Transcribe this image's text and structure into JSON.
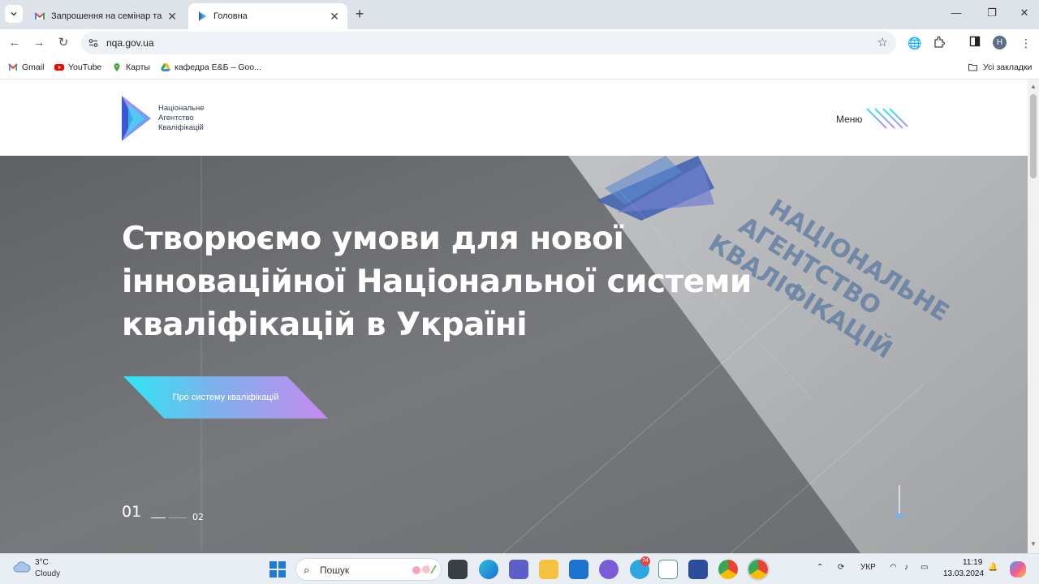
{
  "browser": {
    "tabs": [
      {
        "title": "Запрошення на семінар та під",
        "active": false,
        "icon": "gmail-icon"
      },
      {
        "title": "Головна",
        "active": true,
        "icon": "nqa-icon"
      }
    ],
    "new_tab": "+",
    "url": "nqa.gov.ua",
    "profile_initial": "H",
    "bookmarks": [
      {
        "label": "Gmail",
        "icon": "gmail-icon"
      },
      {
        "label": "YouTube",
        "icon": "youtube-icon"
      },
      {
        "label": "Карты",
        "icon": "maps-icon"
      },
      {
        "label": "кафедра Е&Б – Goo...",
        "icon": "drive-icon"
      }
    ],
    "all_bookmarks": "Усі закладки"
  },
  "site": {
    "logo_lines": [
      "Національне",
      "Агентство",
      "Кваліфікацій"
    ],
    "menu_label": "Меню",
    "hero_title_lines": [
      "Створюємо умови для нової",
      "інноваційної Національної системи",
      "кваліфікацій в Україні"
    ],
    "cta_label": "Про систему кваліфікацій",
    "slide_current": "01",
    "slide_next": "02",
    "background_card_lines": [
      "НАЦІОНАЛЬНЕ",
      "АГЕНТСТВО",
      "КВАЛІФІКАЦІЙ"
    ]
  },
  "taskbar": {
    "weather_temp": "3°C",
    "weather_desc": "Cloudy",
    "search_placeholder": "Пошук",
    "telegram_badge": "74",
    "language": "УКР",
    "time": "11:19",
    "date": "13.03.2024"
  },
  "colors": {
    "accent_cyan": "#2ee7f2",
    "accent_purple": "#c58af0",
    "logo_blue": "#3a58d6"
  }
}
